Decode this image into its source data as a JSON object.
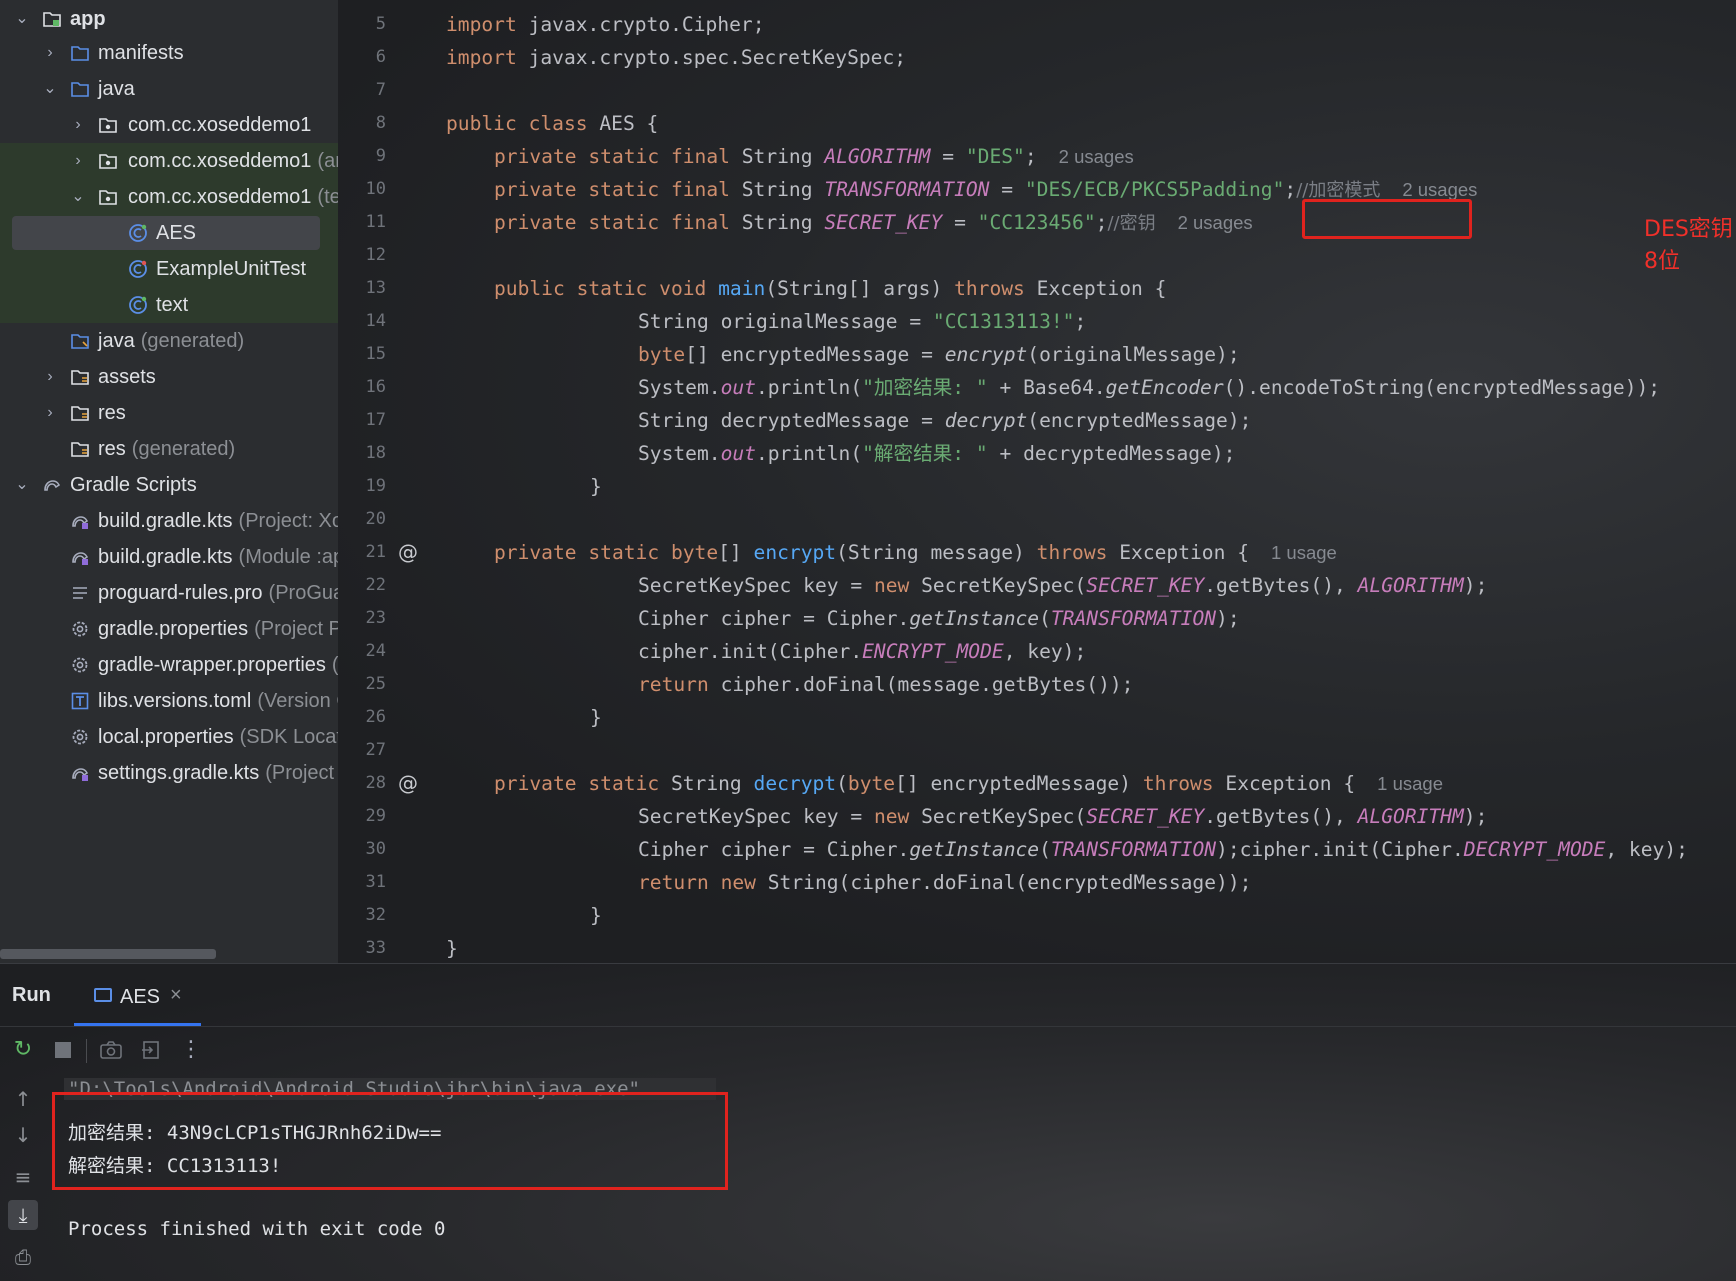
{
  "tree": {
    "rows": [
      {
        "label": "app",
        "hint": ""
      },
      {
        "label": "manifests",
        "hint": ""
      },
      {
        "label": "java",
        "hint": ""
      },
      {
        "label": "com.cc.xoseddemo1",
        "hint": ""
      },
      {
        "label": "com.cc.xoseddemo1",
        "hint": "(and"
      },
      {
        "label": "com.cc.xoseddemo1",
        "hint": "(tes"
      },
      {
        "label": "AES",
        "hint": ""
      },
      {
        "label": "ExampleUnitTest",
        "hint": ""
      },
      {
        "label": "text",
        "hint": ""
      },
      {
        "label": "java",
        "hint": "(generated)"
      },
      {
        "label": "assets",
        "hint": ""
      },
      {
        "label": "res",
        "hint": ""
      },
      {
        "label": "res",
        "hint": "(generated)"
      },
      {
        "label": "Gradle Scripts",
        "hint": ""
      },
      {
        "label": "build.gradle.kts",
        "hint": "(Project: Xo"
      },
      {
        "label": "build.gradle.kts",
        "hint": "(Module :ap"
      },
      {
        "label": "proguard-rules.pro",
        "hint": "(ProGua"
      },
      {
        "label": "gradle.properties",
        "hint": "(Project P"
      },
      {
        "label": "gradle-wrapper.properties",
        "hint": "("
      },
      {
        "label": "libs.versions.toml",
        "hint": "(Version C"
      },
      {
        "label": "local.properties",
        "hint": "(SDK Locati"
      },
      {
        "label": "settings.gradle.kts",
        "hint": "(Project S"
      }
    ]
  },
  "editor": {
    "line_numbers": [
      "5",
      "6",
      "7",
      "8",
      "9",
      "10",
      "11",
      "12",
      "13",
      "14",
      "15",
      "16",
      "17",
      "18",
      "19",
      "20",
      "21",
      "22",
      "23",
      "24",
      "25",
      "26",
      "27",
      "28",
      "29",
      "30",
      "31",
      "32",
      "33"
    ],
    "gutter_marks": {
      "line21": "@",
      "line28": "@"
    },
    "code": {
      "l5_kw": "import",
      "l5_rest": " javax.crypto.Cipher;",
      "l6_kw": "import",
      "l6_rest": " javax.crypto.spec.SecretKeySpec;",
      "l8_kw": "public class",
      "l8_rest": " AES {",
      "l9_kw": "private static final",
      "l9_type": " String ",
      "l9_fld": "ALGORITHM",
      "l9_eq": " = ",
      "l9_str": "\"DES\"",
      "l9_end": ";",
      "l9_hint": "2 usages",
      "l10_kw": "private static final",
      "l10_type": " String ",
      "l10_fld": "TRANSFORMATION",
      "l10_eq": " = ",
      "l10_str": "\"DES/ECB/PKCS5Padding\"",
      "l10_end": ";",
      "l10_cmt": "//加密模式",
      "l10_hint": "2 usages",
      "l11_kw": "private static final",
      "l11_type": " String ",
      "l11_fld": "SECRET_KEY",
      "l11_eq": " = ",
      "l11_str": "\"CC123456\"",
      "l11_end": ";",
      "l11_cmt": "//密钥",
      "l11_hint": "2 usages",
      "l13_kw": "public static void",
      "l13_fn": "main",
      "l13_rest": "(String[] args) ",
      "l13_kw2": "throws",
      "l13_rest2": " Exception {",
      "l14": "String originalMessage = ",
      "l14_str": "\"CC1313113!\"",
      "l14_end": ";",
      "l15_kw": "byte",
      "l15_a": "[] encryptedMessage = ",
      "l15_sfn": "encrypt",
      "l15_b": "(originalMessage);",
      "l16_a": "System.",
      "l16_fld": "out",
      "l16_b": ".println(",
      "l16_str": "\"加密结果: \"",
      "l16_c": " + Base64.",
      "l16_sfn": "getEncoder",
      "l16_d": "().encodeToString(encryptedMessage));",
      "l17_a": "String decryptedMessage = ",
      "l17_sfn": "decrypt",
      "l17_b": "(encryptedMessage);",
      "l18_a": "System.",
      "l18_fld": "out",
      "l18_b": ".println(",
      "l18_str": "\"解密结果: \"",
      "l18_c": " + decryptedMessage);",
      "l19": "}",
      "l21_kw": "private static",
      "l21_type": " byte",
      "l21_a": "[] ",
      "l21_fn": "encrypt",
      "l21_b": "(String message) ",
      "l21_kw2": "throws",
      "l21_c": " Exception {",
      "l21_hint": "1 usage",
      "l22_a": "SecretKeySpec key = ",
      "l22_kw": "new",
      "l22_b": " SecretKeySpec(",
      "l22_fld": "SECRET_KEY",
      "l22_c": ".getBytes(), ",
      "l22_fld2": "ALGORITHM",
      "l22_d": ");",
      "l23_a": "Cipher cipher = Cipher.",
      "l23_sfn": "getInstance",
      "l23_b": "(",
      "l23_fld": "TRANSFORMATION",
      "l23_c": ");",
      "l24_a": "cipher.init(Cipher.",
      "l24_fld": "ENCRYPT_MODE",
      "l24_b": ", key);",
      "l25_kw": "return",
      "l25_a": " cipher.doFinal(message.getBytes());",
      "l26": "}",
      "l28_kw": "private static",
      "l28_a": " String ",
      "l28_fn": "decrypt",
      "l28_b": "(",
      "l28_kw2": "byte",
      "l28_c": "[] encryptedMessage) ",
      "l28_kw3": "throws",
      "l28_d": " Exception {",
      "l28_hint": "1 usage",
      "l29_a": "SecretKeySpec key = ",
      "l29_kw": "new",
      "l29_b": " SecretKeySpec(",
      "l29_fld": "SECRET_KEY",
      "l29_c": ".getBytes(), ",
      "l29_fld2": "ALGORITHM",
      "l29_d": ");",
      "l30_a": "Cipher cipher = Cipher.",
      "l30_sfn": "getInstance",
      "l30_b": "(",
      "l30_fld": "TRANSFORMATION",
      "l30_c": ");cipher.init(Cipher.",
      "l30_fld2": "DECRYPT_MODE",
      "l30_d": ", key);",
      "l31_kw": "return",
      "l31_kw2": " new",
      "l31_a": " String(cipher.doFinal(encryptedMessage));",
      "l32": "}",
      "l33": "}"
    },
    "annotation": "DES密钥8位",
    "colors": {
      "keyword": "#cf8e6d",
      "string": "#6aab73",
      "field": "#c77dbb",
      "function": "#56a8f5",
      "highlight_box": "#e0231e"
    }
  },
  "run": {
    "title": "Run",
    "tab_label": "AES",
    "tab_close": "×",
    "console": {
      "command": "\"D:\\Tools\\Android\\Android Studio\\jbr\\bin\\java.exe\" ...",
      "line1": "加密结果: 43N9cLCP1sTHGJRnh62iDw==",
      "line2": "解密结果: CC1313113!",
      "line3": "Process finished with exit code 0"
    }
  }
}
